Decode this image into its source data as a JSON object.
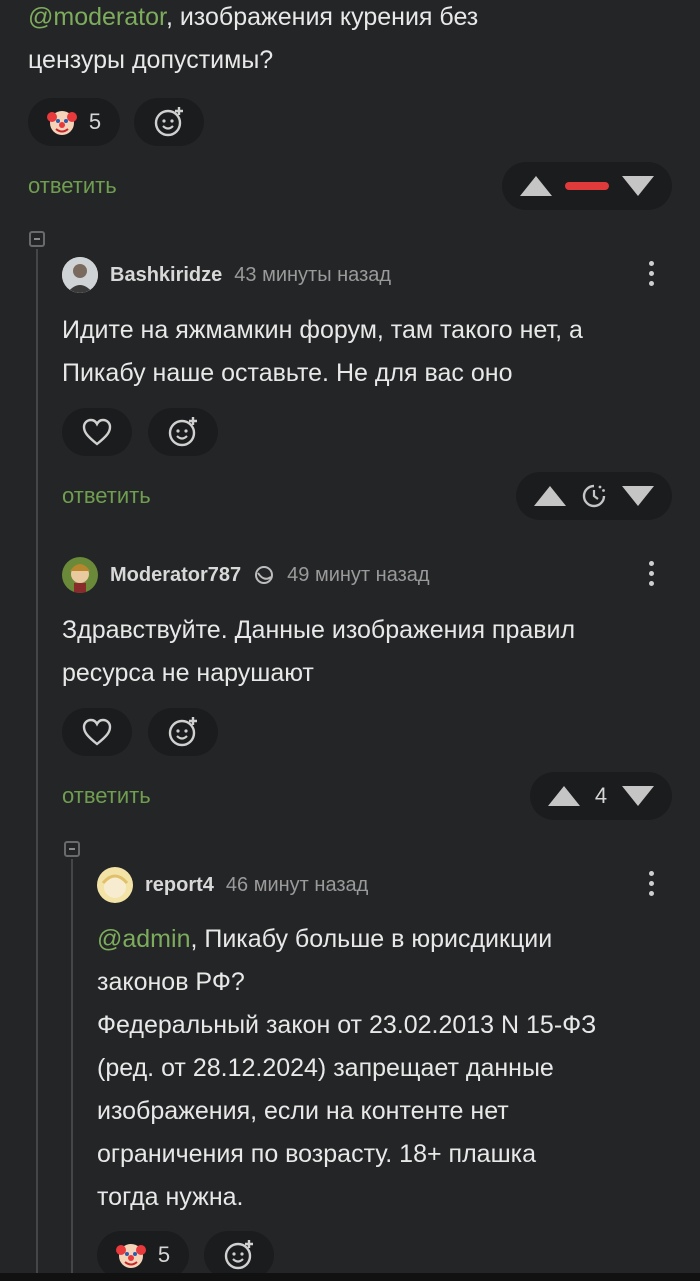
{
  "comments": {
    "c0": {
      "mention": "@moderator",
      "text_line1": ", изображения курения без",
      "text_line2": "цензуры допустимы?",
      "reaction_count": "5",
      "reply_label": "ответить"
    },
    "c1": {
      "username": "Bashkiridze",
      "time": "43 минуты назад",
      "line1": "Идите на яжмамкин форум, там такого нет, а",
      "line2": "Пикабу наше оставьте. Не для вас оно",
      "reply_label": "ответить"
    },
    "c2": {
      "username": "Moderator787",
      "time": "49 минут назад",
      "line1": "Здравствуйте. Данные изображения правил",
      "line2": "ресурса не нарушают",
      "reply_label": "ответить",
      "score": "4"
    },
    "c3": {
      "username": "report4",
      "time": "46 минут назад",
      "mention": "@admin",
      "line1": ", Пикабу больше в юрисдикции",
      "line2": "законов РФ?",
      "line3": "Федеральный закон от 23.02.2013 N 15-ФЗ",
      "line4": "(ред. от 28.12.2024) запрещает данные",
      "line5": "изображения, если на контенте нет",
      "line6": "ограничения по возрасту. 18+ плашка",
      "line7": "тогда нужна.",
      "reaction_count": "5"
    }
  },
  "colors": {
    "background": "#242526",
    "pill": "#1b1c1d",
    "accent_green": "#6f9e50",
    "minus_red": "#e03a3a"
  },
  "icons": [
    "clown-emoji-icon",
    "add-reaction-icon",
    "heart-icon",
    "upvote-icon",
    "downvote-icon",
    "minus-icon",
    "timer-icon",
    "more-icon",
    "moderator-badge-icon",
    "collapse-icon"
  ]
}
